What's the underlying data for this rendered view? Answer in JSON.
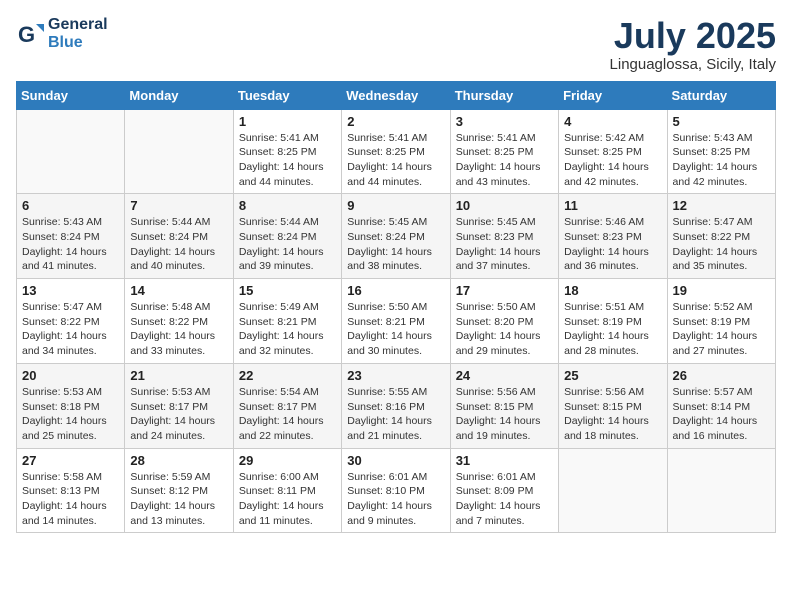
{
  "header": {
    "logo_line1": "General",
    "logo_line2": "Blue",
    "month_title": "July 2025",
    "location": "Linguaglossa, Sicily, Italy"
  },
  "days_of_week": [
    "Sunday",
    "Monday",
    "Tuesday",
    "Wednesday",
    "Thursday",
    "Friday",
    "Saturday"
  ],
  "weeks": [
    [
      {
        "day": "",
        "content": ""
      },
      {
        "day": "",
        "content": ""
      },
      {
        "day": "1",
        "content": "Sunrise: 5:41 AM\nSunset: 8:25 PM\nDaylight: 14 hours and 44 minutes."
      },
      {
        "day": "2",
        "content": "Sunrise: 5:41 AM\nSunset: 8:25 PM\nDaylight: 14 hours and 44 minutes."
      },
      {
        "day": "3",
        "content": "Sunrise: 5:41 AM\nSunset: 8:25 PM\nDaylight: 14 hours and 43 minutes."
      },
      {
        "day": "4",
        "content": "Sunrise: 5:42 AM\nSunset: 8:25 PM\nDaylight: 14 hours and 42 minutes."
      },
      {
        "day": "5",
        "content": "Sunrise: 5:43 AM\nSunset: 8:25 PM\nDaylight: 14 hours and 42 minutes."
      }
    ],
    [
      {
        "day": "6",
        "content": "Sunrise: 5:43 AM\nSunset: 8:24 PM\nDaylight: 14 hours and 41 minutes."
      },
      {
        "day": "7",
        "content": "Sunrise: 5:44 AM\nSunset: 8:24 PM\nDaylight: 14 hours and 40 minutes."
      },
      {
        "day": "8",
        "content": "Sunrise: 5:44 AM\nSunset: 8:24 PM\nDaylight: 14 hours and 39 minutes."
      },
      {
        "day": "9",
        "content": "Sunrise: 5:45 AM\nSunset: 8:24 PM\nDaylight: 14 hours and 38 minutes."
      },
      {
        "day": "10",
        "content": "Sunrise: 5:45 AM\nSunset: 8:23 PM\nDaylight: 14 hours and 37 minutes."
      },
      {
        "day": "11",
        "content": "Sunrise: 5:46 AM\nSunset: 8:23 PM\nDaylight: 14 hours and 36 minutes."
      },
      {
        "day": "12",
        "content": "Sunrise: 5:47 AM\nSunset: 8:22 PM\nDaylight: 14 hours and 35 minutes."
      }
    ],
    [
      {
        "day": "13",
        "content": "Sunrise: 5:47 AM\nSunset: 8:22 PM\nDaylight: 14 hours and 34 minutes."
      },
      {
        "day": "14",
        "content": "Sunrise: 5:48 AM\nSunset: 8:22 PM\nDaylight: 14 hours and 33 minutes."
      },
      {
        "day": "15",
        "content": "Sunrise: 5:49 AM\nSunset: 8:21 PM\nDaylight: 14 hours and 32 minutes."
      },
      {
        "day": "16",
        "content": "Sunrise: 5:50 AM\nSunset: 8:21 PM\nDaylight: 14 hours and 30 minutes."
      },
      {
        "day": "17",
        "content": "Sunrise: 5:50 AM\nSunset: 8:20 PM\nDaylight: 14 hours and 29 minutes."
      },
      {
        "day": "18",
        "content": "Sunrise: 5:51 AM\nSunset: 8:19 PM\nDaylight: 14 hours and 28 minutes."
      },
      {
        "day": "19",
        "content": "Sunrise: 5:52 AM\nSunset: 8:19 PM\nDaylight: 14 hours and 27 minutes."
      }
    ],
    [
      {
        "day": "20",
        "content": "Sunrise: 5:53 AM\nSunset: 8:18 PM\nDaylight: 14 hours and 25 minutes."
      },
      {
        "day": "21",
        "content": "Sunrise: 5:53 AM\nSunset: 8:17 PM\nDaylight: 14 hours and 24 minutes."
      },
      {
        "day": "22",
        "content": "Sunrise: 5:54 AM\nSunset: 8:17 PM\nDaylight: 14 hours and 22 minutes."
      },
      {
        "day": "23",
        "content": "Sunrise: 5:55 AM\nSunset: 8:16 PM\nDaylight: 14 hours and 21 minutes."
      },
      {
        "day": "24",
        "content": "Sunrise: 5:56 AM\nSunset: 8:15 PM\nDaylight: 14 hours and 19 minutes."
      },
      {
        "day": "25",
        "content": "Sunrise: 5:56 AM\nSunset: 8:15 PM\nDaylight: 14 hours and 18 minutes."
      },
      {
        "day": "26",
        "content": "Sunrise: 5:57 AM\nSunset: 8:14 PM\nDaylight: 14 hours and 16 minutes."
      }
    ],
    [
      {
        "day": "27",
        "content": "Sunrise: 5:58 AM\nSunset: 8:13 PM\nDaylight: 14 hours and 14 minutes."
      },
      {
        "day": "28",
        "content": "Sunrise: 5:59 AM\nSunset: 8:12 PM\nDaylight: 14 hours and 13 minutes."
      },
      {
        "day": "29",
        "content": "Sunrise: 6:00 AM\nSunset: 8:11 PM\nDaylight: 14 hours and 11 minutes."
      },
      {
        "day": "30",
        "content": "Sunrise: 6:01 AM\nSunset: 8:10 PM\nDaylight: 14 hours and 9 minutes."
      },
      {
        "day": "31",
        "content": "Sunrise: 6:01 AM\nSunset: 8:09 PM\nDaylight: 14 hours and 7 minutes."
      },
      {
        "day": "",
        "content": ""
      },
      {
        "day": "",
        "content": ""
      }
    ]
  ]
}
